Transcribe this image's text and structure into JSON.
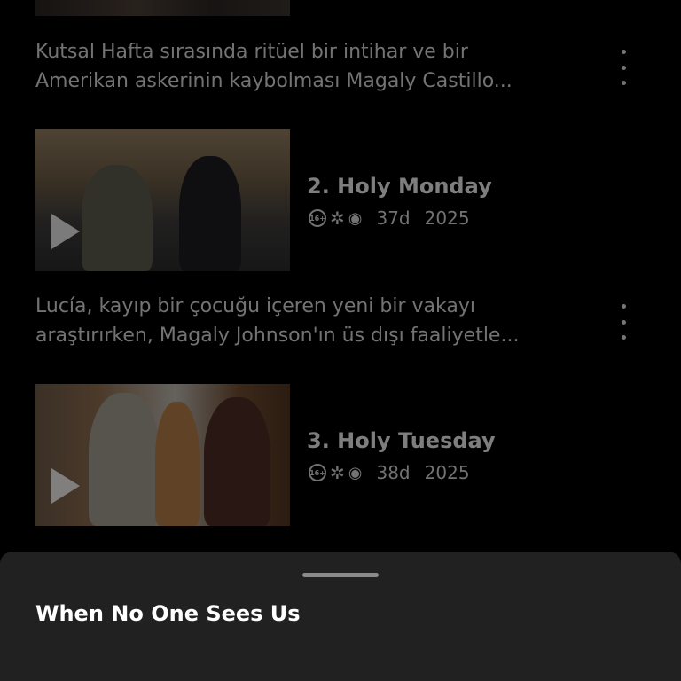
{
  "episodes": [
    {
      "description_line1": "Kutsal Hafta sırasında ritüel bir intihar ve bir",
      "description_line2": "Amerikan askerinin kaybolması Magaly Castillo..."
    },
    {
      "title": "2. Holy Monday",
      "rating": "16+",
      "icons": [
        "rating-16-icon",
        "violence-icon",
        "fear-icon"
      ],
      "duration": "37d",
      "year": "2025",
      "description_line1": "Lucía, kayıp bir çocuğu içeren yeni bir vakayı",
      "description_line2": "araştırırken, Magaly Johnson'ın üs dışı faaliyetle..."
    },
    {
      "title": "3. Holy Tuesday",
      "rating": "16+",
      "icons": [
        "rating-16-icon",
        "violence-icon",
        "fear-icon"
      ],
      "duration": "38d",
      "year": "2025"
    }
  ],
  "sheet": {
    "title": "When No One Sees Us"
  }
}
